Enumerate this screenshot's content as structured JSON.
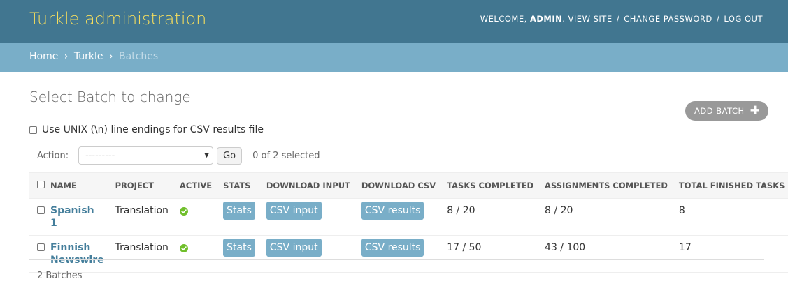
{
  "header": {
    "branding": "Turkle administration",
    "welcome": "Welcome,",
    "username": "admin",
    "period": ".",
    "view_site": "View site",
    "change_password": "Change password",
    "log_out": "Log out",
    "separator": "/"
  },
  "breadcrumbs": {
    "home": "Home",
    "app": "Turkle",
    "current": "Batches",
    "separator": "›"
  },
  "page": {
    "title": "Select Batch to change",
    "add_label": "Add Batch",
    "add_icon": "plus-icon"
  },
  "options": {
    "unix_line_endings": "Use UNIX (\\n) line endings for CSV results file"
  },
  "actions": {
    "label": "Action:",
    "selected_value": "---------",
    "go_label": "Go",
    "selected_count": "0 of 2 selected"
  },
  "table": {
    "headers": [
      "Name",
      "Project",
      "Active",
      "Stats",
      "Download input",
      "Download CSV",
      "Tasks completed",
      "Assignments completed",
      "Total finished tasks"
    ],
    "rows": [
      {
        "name": "Spanish 1",
        "project": "Translation",
        "active_icon": "check-circle-icon",
        "stats": "Stats",
        "download_input": "CSV input",
        "download_csv": "CSV results",
        "tasks_completed": "8 / 20",
        "assignments_completed": "8 / 20",
        "total_finished": "8"
      },
      {
        "name": "Finnish Newswire",
        "project": "Translation",
        "active_icon": "check-circle-icon",
        "stats": "Stats",
        "download_input": "CSV input",
        "download_csv": "CSV results",
        "tasks_completed": "17 / 50",
        "assignments_completed": "43 / 100",
        "total_finished": "17"
      }
    ]
  },
  "paginator": {
    "count": "2 Batches"
  },
  "colors": {
    "header_bg": "#417690",
    "branding": "#f5dd5d",
    "breadcrumbs_bg": "#79aec8",
    "link": "#447e9b",
    "button": "#79aec8",
    "active_ok": "#70bf2b"
  }
}
